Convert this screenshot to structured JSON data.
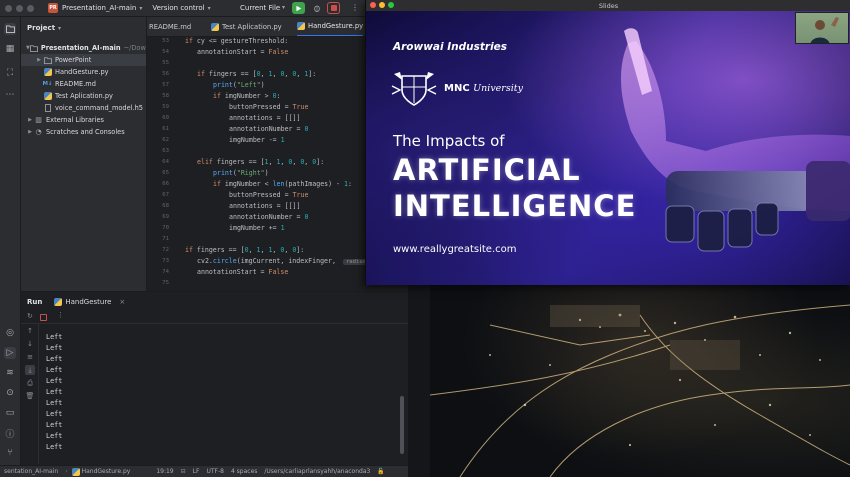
{
  "ide": {
    "project_badge": "PR",
    "project_name": "Presentation_AI-main",
    "vcs": "Version control",
    "run_config": "Current File"
  },
  "project_panel": {
    "title": "Project",
    "root": "Presentation_AI-main",
    "root_path": "~/Downk",
    "items": [
      {
        "label": "PowerPoint",
        "icon": "folder-icon"
      },
      {
        "label": "HandGesture.py",
        "icon": "python-file-icon"
      },
      {
        "label": "README.md",
        "icon": "markdown-file-icon"
      },
      {
        "label": "Test Aplication.py",
        "icon": "python-file-icon"
      },
      {
        "label": "voice_command_model.h5",
        "icon": "file-icon"
      }
    ],
    "external_libraries": "External Libraries",
    "scratches": "Scratches and Consoles"
  },
  "editor": {
    "tabs": [
      {
        "label": "README.md"
      },
      {
        "label": "Test Aplication.py"
      },
      {
        "label": "HandGesture.py"
      }
    ],
    "line_numbers": [
      "53",
      "54",
      "55",
      "56",
      "57",
      "58",
      "59",
      "60",
      "61",
      "62",
      "63",
      "64",
      "65",
      "66",
      "67",
      "68",
      "69",
      "70",
      "71",
      "72",
      "73",
      "74",
      "75",
      "76"
    ],
    "hint_radius": "radius"
  },
  "run_panel": {
    "tab_run": "Run",
    "tab_config": "HandGesture",
    "output": [
      "Left",
      "Left",
      "Left",
      "Left",
      "Left",
      "Left",
      "Left",
      "Left",
      "Left",
      "Left",
      "Left"
    ]
  },
  "status_bar": {
    "breadcrumb": "sentation_AI-main",
    "file": "HandGesture.py",
    "position": "19:19",
    "line_ending": "LF",
    "encoding": "UTF-8",
    "indent": "4 spaces",
    "interpreter_path": "/Users/carliaprlansyahh/anaconda3"
  },
  "slides_window": {
    "title": "Slides",
    "company": "Arowwai Industries",
    "university_mark": "MNC",
    "university_word": "University",
    "headline_small": "The Impacts of",
    "headline_big_1": "ARTIFICIAL",
    "headline_big_2": "INTELLIGENCE",
    "website": "www.reallygreatsite.com"
  },
  "colors": {
    "accent_blue": "#3574f0",
    "slide_purple": "#2a1f86",
    "run_green": "#3fa34d",
    "stop_red": "#c94f4f"
  }
}
